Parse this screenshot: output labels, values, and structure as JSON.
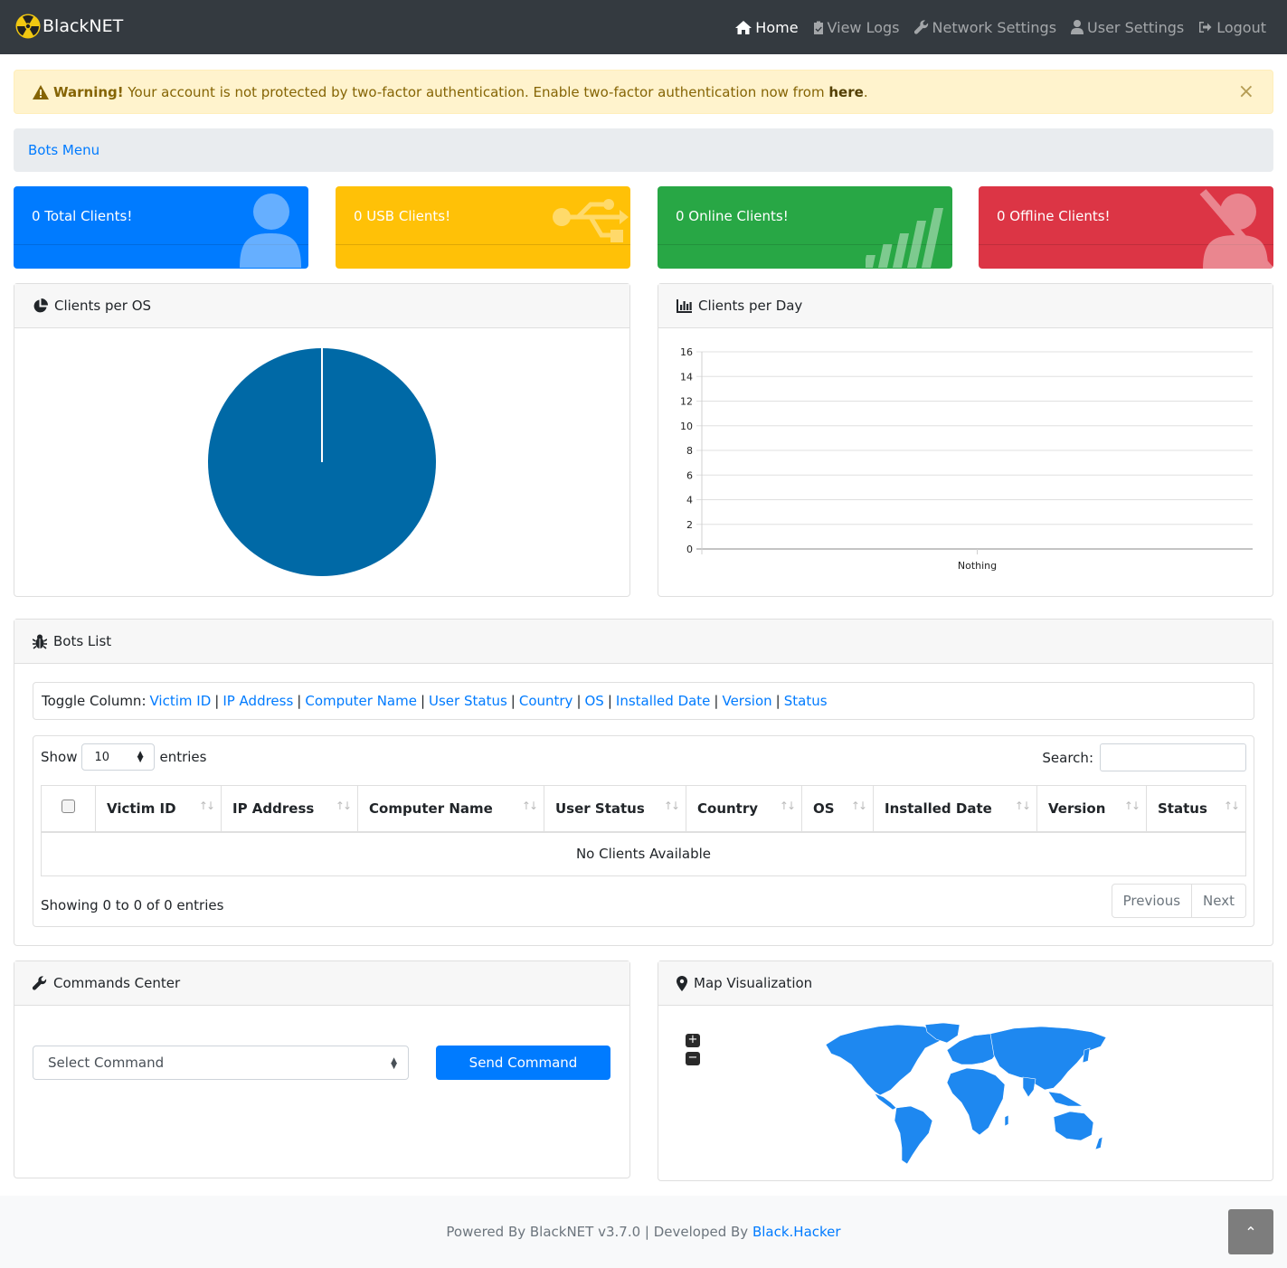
{
  "navbar": {
    "brand": "BlackNET",
    "links": [
      {
        "label": "Home",
        "icon": "home-icon",
        "active": true
      },
      {
        "label": "View Logs",
        "icon": "clipboard-icon"
      },
      {
        "label": "Network Settings",
        "icon": "wrench-icon"
      },
      {
        "label": "User Settings",
        "icon": "user-icon"
      },
      {
        "label": "Logout",
        "icon": "sign-out-icon"
      }
    ]
  },
  "alert": {
    "strong": "Warning!",
    "text": "Your account is not protected by two-factor authentication. Enable two-factor authentication now from",
    "link": "here",
    "end": ".",
    "close": "×"
  },
  "breadcrumb": {
    "label": "Bots Menu"
  },
  "stats": [
    {
      "label": "0 Total Clients!",
      "color": "#007bff",
      "icon": "user-icon"
    },
    {
      "label": "0 USB Clients!",
      "color": "#ffc107",
      "icon": "usb-icon"
    },
    {
      "label": "0 Online Clients!",
      "color": "#28a745",
      "icon": "signal-icon"
    },
    {
      "label": "0 Offline Clients!",
      "color": "#dc3545",
      "icon": "user-slash-icon"
    }
  ],
  "os_card": {
    "title": "Clients per OS"
  },
  "day_card": {
    "title": "Clients per Day"
  },
  "chart_data": [
    {
      "type": "pie",
      "title": "Clients per OS",
      "labels": [],
      "values": [
        1
      ],
      "colors": [
        "#0069a6"
      ]
    },
    {
      "type": "line",
      "title": "Clients per Day",
      "categories": [
        "Nothing"
      ],
      "series": [
        {
          "values": [
            0
          ]
        }
      ],
      "ylim": [
        0,
        16
      ],
      "yticks": [
        0,
        2,
        4,
        6,
        8,
        10,
        12,
        14,
        16
      ],
      "grid": true
    }
  ],
  "bots": {
    "title": "Bots List",
    "toggle_label": "Toggle Column:",
    "columns": [
      "Victim ID",
      "IP Address",
      "Computer Name",
      "User Status",
      "Country",
      "OS",
      "Installed Date",
      "Version",
      "Status"
    ],
    "show": "Show",
    "length": "10",
    "entries": "entries",
    "search": "Search:",
    "empty": "No Clients Available",
    "info": "Showing 0 to 0 of 0 entries",
    "prev": "Previous",
    "next": "Next"
  },
  "commands": {
    "title": "Commands Center",
    "select": "Select Command",
    "button": "Send Command"
  },
  "map": {
    "title": "Map Visualization",
    "zoom_in": "+",
    "zoom_out": "−"
  },
  "footer": {
    "text": "Powered By BlackNET v3.7.0 | Developed By",
    "link": "Black.Hacker"
  },
  "totop": "⌃"
}
